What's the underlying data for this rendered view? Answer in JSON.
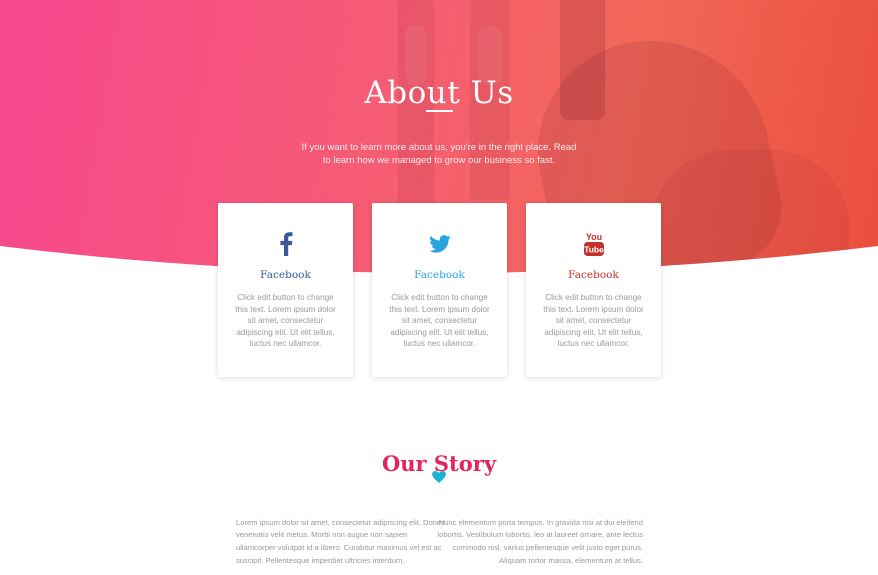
{
  "hero": {
    "title": "About Us",
    "subtitle": "If you want to learn more about us, you're in the right place. Read to learn how we managed to grow our business so fast."
  },
  "cards": [
    {
      "icon": "facebook-icon",
      "title": "Facebook",
      "title_color": "#3b5998",
      "text": "Click edit button to change this text. Lorem ipsum dolor sit amet, consectetur adipiscing elit. Ut elit tellus, luctus nec ullamcor."
    },
    {
      "icon": "twitter-icon",
      "title": "Facebook",
      "title_color": "#2aa4e0",
      "text": "Click edit button to change this text. Lorem ipsum dolor sit amet, consectetur adipiscing elit. Ut elit tellus, luctus nec ullamcor."
    },
    {
      "icon": "youtube-icon",
      "title": "Facebook",
      "title_color": "#c4302b",
      "text": "Click edit button to change this text. Lorem ipsum dolor sit amet, consectetur adipiscing elit. Ut elit tellus, luctus nec ullamcor."
    }
  ],
  "story": {
    "title": "Our Story",
    "heart_icon": "heart-icon",
    "left_text": "Lorem ipsum dolor sit amet, consectetur adipiscing elit. Donec venenatis velit metus. Morbi non augue non sapien ullamcorper volutpat id a libero. Curabitur maximus vel est ac suscipit. Pellentesque imperdiet ultricies interdum.",
    "right_text": "Nunc elementum porta tempus. In gravida nisi at dui eleifend lobortis. Vestibulum lobortis, leo at laoreet ornare, ante lectus commodo nisl, varius pellentesque velit justo eget purus. Aliquam tortor massa, elementum at tellus."
  },
  "colors": {
    "hero_gradient_start": "#f7478f",
    "hero_gradient_end": "#ea4e3c",
    "story_title": "#e5245b",
    "heart": "#1ab3d6"
  }
}
